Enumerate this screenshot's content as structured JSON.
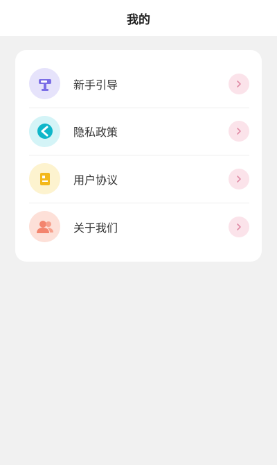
{
  "header": {
    "title": "我的"
  },
  "menu": {
    "items": [
      {
        "label": "新手引导",
        "icon": "signpost-icon",
        "icon_bg": "#e6e3fb",
        "icon_color": "#7b6ee6"
      },
      {
        "label": "隐私政策",
        "icon": "shield-icon",
        "icon_bg": "#d4f4f7",
        "icon_color": "#0fb6c9"
      },
      {
        "label": "用户协议",
        "icon": "agreement-doc-icon",
        "icon_bg": "#fdf3cf",
        "icon_color": "#f3b81b"
      },
      {
        "label": "关于我们",
        "icon": "users-icon",
        "icon_bg": "#fde0d8",
        "icon_color": "#f3846d"
      }
    ],
    "arrow_bg": "#fbe3ea",
    "arrow_color": "#e08aa5"
  }
}
